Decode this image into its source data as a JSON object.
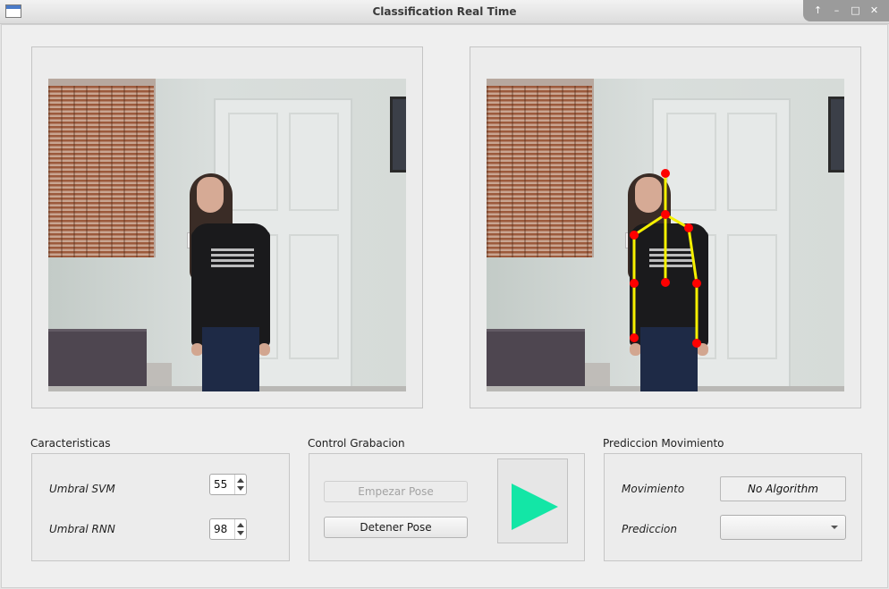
{
  "window": {
    "title": "Classification Real Time",
    "controls": [
      "restore-icon",
      "minimize-icon",
      "maximize-icon",
      "close-icon"
    ],
    "control_glyphs": [
      "↑",
      "–",
      "□",
      "✕"
    ]
  },
  "caracteristicas": {
    "title": "Caracteristicas",
    "umbral_svm": {
      "label": "Umbral SVM",
      "value": "55"
    },
    "umbral_rnn": {
      "label": "Umbral RNN",
      "value": "98"
    }
  },
  "control_grabacion": {
    "title": "Control Grabacion",
    "start_label": "Empezar Pose",
    "stop_label": "Detener Pose",
    "play_icon": "play-icon",
    "play_color": "#13e6a6"
  },
  "prediccion_movimiento": {
    "title": "Prediccion Movimiento",
    "movimiento_label": "Movimiento",
    "movimiento_value": "No Algorithm",
    "prediccion_label": "Prediccion",
    "prediccion_value": ""
  },
  "colors": {
    "skeleton_line": "#f5f000",
    "skeleton_joint": "#ff0000"
  }
}
